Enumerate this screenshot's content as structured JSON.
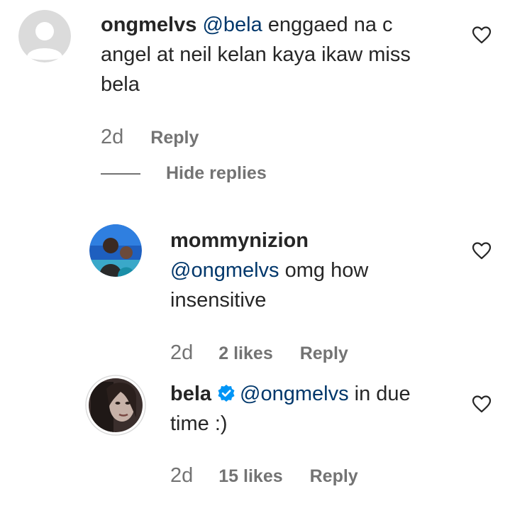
{
  "comments": [
    {
      "username": "ongmelvs",
      "mention": "@bela",
      "text_line1_rest": " enggaed na c",
      "text_line2": "angel at neil kelan kaya ikaw miss",
      "text_line3": "bela",
      "time": "2d",
      "reply_label": "Reply",
      "hide_replies_label": "Hide replies"
    },
    {
      "username": "mommynizion",
      "mention": "@ongmelvs",
      "text_rest": " omg how",
      "text_line3": "insensitive",
      "time": "2d",
      "likes": "2 likes",
      "reply_label": "Reply"
    },
    {
      "username": "bela",
      "mention": "@ongmelvs",
      "text_rest": " in due",
      "text_line2": "time :)",
      "time": "2d",
      "likes": "15 likes",
      "reply_label": "Reply",
      "verified": true
    }
  ],
  "icons": {
    "like": "heart-outline-icon",
    "verified": "verified-badge-icon",
    "default_avatar": "default-avatar-icon"
  },
  "colors": {
    "text": "#262626",
    "secondary": "#737373",
    "mention": "#00376b",
    "verified": "#0095f6"
  }
}
